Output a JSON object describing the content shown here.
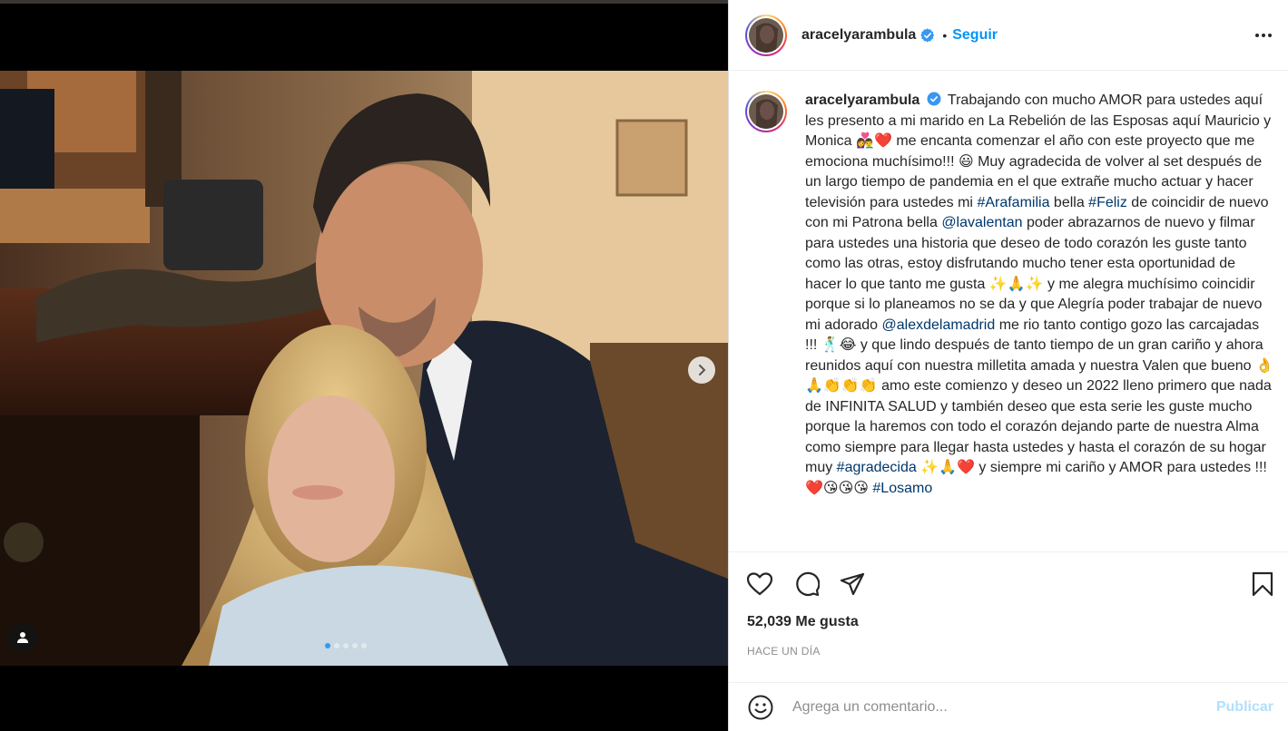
{
  "post": {
    "username": "aracelyarambula",
    "follow_label": "Seguir",
    "separator": "•",
    "caption_segments": [
      {
        "t": "Trabajando con mucho AMOR para ustedes aquí les presento a mi marido en La Rebelión de las Esposas aquí Mauricio y Monica 👩‍❤️‍👨❤️ me encanta comenzar el año con este proyecto que me emociona muchísimo!!! 😃 Muy agradecida de volver al set después de un largo tiempo de pandemia en el que extrañe mucho actuar y hacer televisión para ustedes mi ",
        "link": false
      },
      {
        "t": "#Arafamilia",
        "link": true
      },
      {
        "t": " bella ",
        "link": false
      },
      {
        "t": "#Feliz",
        "link": true
      },
      {
        "t": " de coincidir de nuevo con mi Patrona bella ",
        "link": false
      },
      {
        "t": "@lavalentan",
        "link": true
      },
      {
        "t": " poder abrazarnos de nuevo y filmar para ustedes una historia que deseo de todo corazón les guste tanto como las otras, estoy disfrutando mucho tener esta oportunidad de hacer lo que tanto me gusta ✨🙏✨ y me alegra muchísimo coincidir porque si lo planeamos no se da y que Alegría poder trabajar de nuevo mi adorado ",
        "link": false
      },
      {
        "t": "@alexdelamadrid",
        "link": true
      },
      {
        "t": " me rio tanto contigo gozo las carcajadas !!! 🕺😂 y que lindo después de tanto tiempo de un gran cariño y ahora reunidos aquí con nuestra milletita amada y nuestra Valen que bueno 👌🙏👏👏👏 amo este comienzo y deseo un 2022 lleno primero que nada de INFINITA SALUD y también deseo que esta serie les guste mucho porque la haremos con todo el corazón dejando parte de nuestra Alma como siempre para llegar hasta ustedes y hasta el corazón de su hogar muy ",
        "link": false
      },
      {
        "t": "#agradecida",
        "link": true
      },
      {
        "t": " ✨🙏❤️ y siempre mi cariño y AMOR para ustedes !!! ❤️😘😘😘 ",
        "link": false
      },
      {
        "t": "#Losamo",
        "link": true
      }
    ],
    "likes_label": "52,039 Me gusta",
    "time_label": "HACE UN DÍA",
    "comment_placeholder": "Agrega un comentario...",
    "publish_label": "Publicar"
  },
  "media": {
    "slide_count": 5,
    "active_slide": 1
  },
  "colors": {
    "accent": "#0095f6",
    "link": "#00376b",
    "publish_disabled": "#b2dffc",
    "muted": "#8e8e8e"
  },
  "icons": [
    "verified-badge-icon",
    "more-options-icon",
    "heart-icon",
    "comment-icon",
    "share-icon",
    "bookmark-icon",
    "emoji-icon",
    "chevron-right-icon",
    "tag-user-icon"
  ]
}
